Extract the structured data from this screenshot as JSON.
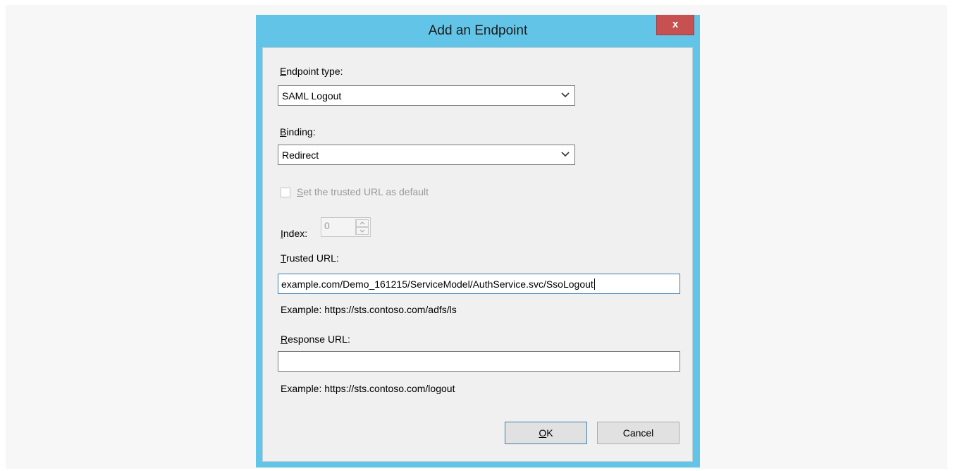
{
  "window": {
    "title": "Add an Endpoint",
    "close_glyph": "x"
  },
  "endpoint_type": {
    "label_accel": "E",
    "label_rest": "ndpoint type:",
    "value": "SAML Logout"
  },
  "binding": {
    "label_accel": "B",
    "label_rest": "inding:",
    "value": "Redirect"
  },
  "default_checkbox": {
    "label_accel": "S",
    "label_rest": "et the trusted URL as default",
    "checked": false,
    "enabled": false
  },
  "index": {
    "label_accel": "I",
    "label_rest": "ndex:",
    "value": "0",
    "enabled": false
  },
  "trusted_url": {
    "label_accel": "T",
    "label_rest": "rusted URL:",
    "value": "example.com/Demo_161215/ServiceModel/AuthService.svc/SsoLogout",
    "example": "Example: https://sts.contoso.com/adfs/ls"
  },
  "response_url": {
    "label_accel": "R",
    "label_rest": "esponse URL:",
    "value": "",
    "example": "Example: https://sts.contoso.com/logout"
  },
  "buttons": {
    "ok_accel": "O",
    "ok_rest": "K",
    "cancel": "Cancel"
  },
  "colors": {
    "frame": "#62c5e8",
    "close": "#c75050",
    "client": "#f0f0f0"
  },
  "icons": [
    "close-icon",
    "chevron-down-icon",
    "spin-up-icon",
    "spin-down-icon"
  ]
}
